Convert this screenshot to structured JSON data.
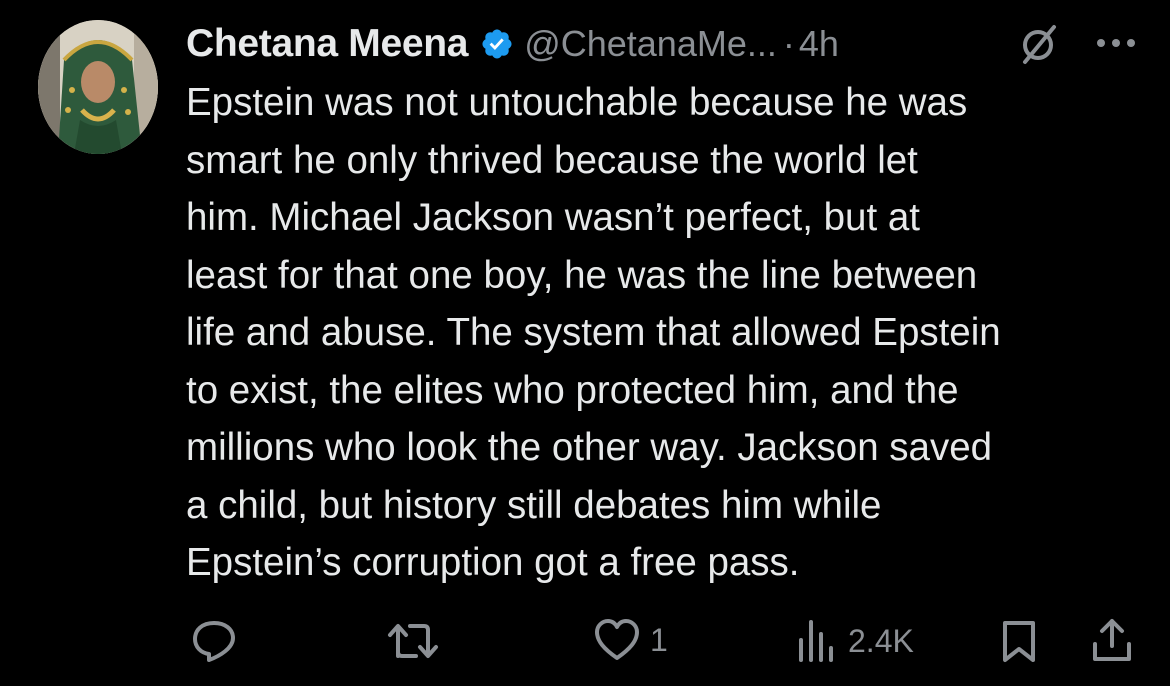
{
  "tweet": {
    "display_name": "Chetana Meena",
    "handle": "@ChetanaMe...",
    "separator": "·",
    "time": "4h",
    "text": "Epstein was not untouchable because he was\nsmart he only thrived because the world let\nhim. Michael Jackson wasn’t perfect, but  at\nleast for that one boy, he was the line between\nlife and abuse. The system that allowed Epstein\nto exist, the elites who protected him, and the\nmillions who look the other way. Jackson saved\na child, but history still debates him while\nEpstein’s corruption got a free pass.",
    "verified_color": "#1d9bf0"
  },
  "actions": {
    "reply_icon": "reply-icon",
    "retweet_icon": "retweet-icon",
    "like_icon": "heart-icon",
    "like_count": "1",
    "views_icon": "views-icon",
    "views_count": "2.4K",
    "bookmark_icon": "bookmark-icon",
    "share_icon": "share-icon"
  },
  "colors": {
    "background": "#000000",
    "text": "#e7e9ea",
    "muted": "#8b8f94"
  }
}
